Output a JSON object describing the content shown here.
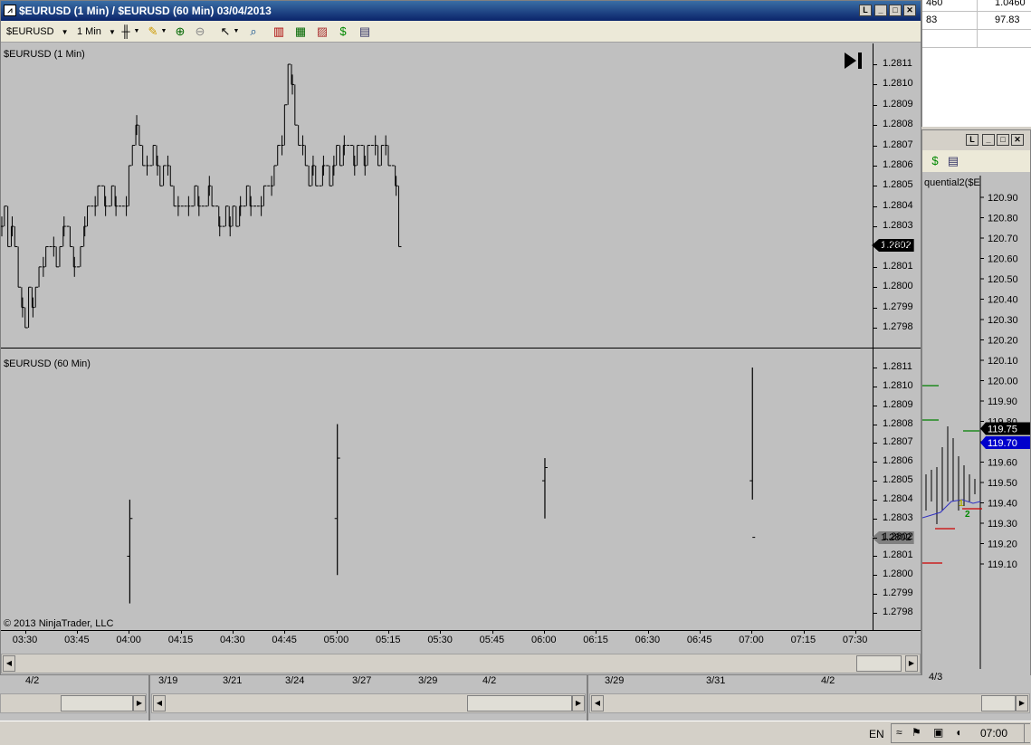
{
  "main_window": {
    "title": "$EURUSD (1 Min) / $EURUSD (60 Min)  03/04/2013",
    "toolbar": {
      "instrument": "$EURUSD",
      "interval": "1 Min"
    }
  },
  "top_panel": {
    "label": "$EURUSD (1 Min)",
    "price_ticks": [
      "1.2811",
      "1.2810",
      "1.2809",
      "1.2808",
      "1.2807",
      "1.2806",
      "1.2805",
      "1.2804",
      "1.2803",
      "1.2802",
      "1.2801",
      "1.2800",
      "1.2799",
      "1.2798"
    ],
    "last_price": "1.2802"
  },
  "bottom_panel": {
    "label": "$EURUSD (60 Min)",
    "price_ticks": [
      "1.2811",
      "1.2810",
      "1.2809",
      "1.2808",
      "1.2807",
      "1.2806",
      "1.2805",
      "1.2804",
      "1.2803",
      "1.2802",
      "1.2801",
      "1.2800",
      "1.2799",
      "1.2798"
    ],
    "last_price": "1.2802",
    "copyright": "© 2013 NinjaTrader, LLC"
  },
  "time_axis": [
    "03:30",
    "03:45",
    "04:00",
    "04:15",
    "04:30",
    "04:45",
    "05:00",
    "05:15",
    "05:30",
    "05:45",
    "06:00",
    "06:15",
    "06:30",
    "06:45",
    "07:00",
    "07:15",
    "07:30"
  ],
  "lower_strip": {
    "left_date": "4/2",
    "middle_dates": [
      "3/19",
      "3/21",
      "3/24",
      "3/27",
      "3/29",
      "4/2"
    ],
    "right_dates": [
      "3/29",
      "3/31",
      "4/2"
    ],
    "far_right_date": "4/3"
  },
  "top_right_table": {
    "rows": [
      [
        "460",
        "1.0460"
      ],
      [
        "83",
        "97.83"
      ],
      [
        "",
        ""
      ]
    ]
  },
  "right_window": {
    "label": "quential2($E",
    "price_ticks": [
      "120.90",
      "120.80",
      "120.70",
      "120.60",
      "120.50",
      "120.40",
      "120.30",
      "120.20",
      "120.10",
      "120.00",
      "119.90",
      "119.80",
      "119.70",
      "119.60",
      "119.50",
      "119.40",
      "119.30",
      "119.20",
      "119.10"
    ],
    "price_tag_black": "119.75",
    "price_tag_blue": "119.70",
    "marker_1": "1",
    "marker_2": "2",
    "colors": {
      "blue_tag": "#0000cc",
      "red_line": "#cc0000",
      "green_line": "#008000"
    }
  },
  "taskbar": {
    "language": "EN",
    "clock": "07:00"
  },
  "chart_data": [
    {
      "type": "bar",
      "title": "$EURUSD (1 Min)",
      "ylim": [
        1.27975,
        1.28115
      ],
      "xlim": [
        "03:23",
        "07:35"
      ],
      "x_start": "03:23",
      "y": [
        1.2803,
        1.2804,
        1.2802,
        1.2803,
        1.2802,
        1.28,
        1.2799,
        1.2798,
        1.28,
        1.2799,
        1.28,
        1.2801,
        1.2801,
        1.2802,
        1.2802,
        1.2802,
        1.2801,
        1.2802,
        1.2803,
        1.2803,
        1.2802,
        1.2801,
        1.2801,
        1.2802,
        1.2803,
        1.2804,
        1.2804,
        1.2804,
        1.2805,
        1.2805,
        1.2804,
        1.2804,
        1.2805,
        1.2804,
        1.2804,
        1.2804,
        1.2804,
        1.2806,
        1.2807,
        1.2808,
        1.2807,
        1.2806,
        1.2806,
        1.2806,
        1.2807,
        1.2806,
        1.2805,
        1.2806,
        1.2806,
        1.2805,
        1.2804,
        1.2804,
        1.2804,
        1.2804,
        1.2804,
        1.2804,
        1.2805,
        1.2804,
        1.2804,
        1.2804,
        1.2805,
        1.2804,
        1.2804,
        1.2803,
        1.2803,
        1.2804,
        1.2803,
        1.2804,
        1.2803,
        1.2804,
        1.2804,
        1.2805,
        1.2804,
        1.2804,
        1.2804,
        1.2804,
        1.2805,
        1.2805,
        1.2805,
        1.2806,
        1.2807,
        1.2807,
        1.2809,
        1.2811,
        1.281,
        1.2808,
        1.2807,
        1.2807,
        1.2806,
        1.2805,
        1.2806,
        1.2805,
        1.2805,
        1.2806,
        1.2806,
        1.2805,
        1.2806,
        1.2807,
        1.2806,
        1.2807,
        1.2807,
        1.2807,
        1.2806,
        1.2807,
        1.2807,
        1.2806,
        1.2807,
        1.2807,
        1.2807,
        1.2806,
        1.2807,
        1.2807,
        1.2806,
        1.2806,
        1.2805,
        1.2802
      ]
    },
    {
      "type": "bar",
      "title": "$EURUSD (60 Min)",
      "ylim": [
        1.27975,
        1.28115
      ],
      "bars": [
        {
          "x": "04:00",
          "open": 1.2801,
          "high": 1.2804,
          "low": 1.27985,
          "close": 1.2803
        },
        {
          "x": "05:00",
          "open": 1.2803,
          "high": 1.2808,
          "low": 1.28,
          "close": 1.28062
        },
        {
          "x": "06:00",
          "open": 1.2805,
          "high": 1.28062,
          "low": 1.2803,
          "close": 1.28057
        },
        {
          "x": "07:00",
          "open": 1.2805,
          "high": 1.2811,
          "low": 1.2804,
          "close": 1.2802
        }
      ]
    }
  ]
}
